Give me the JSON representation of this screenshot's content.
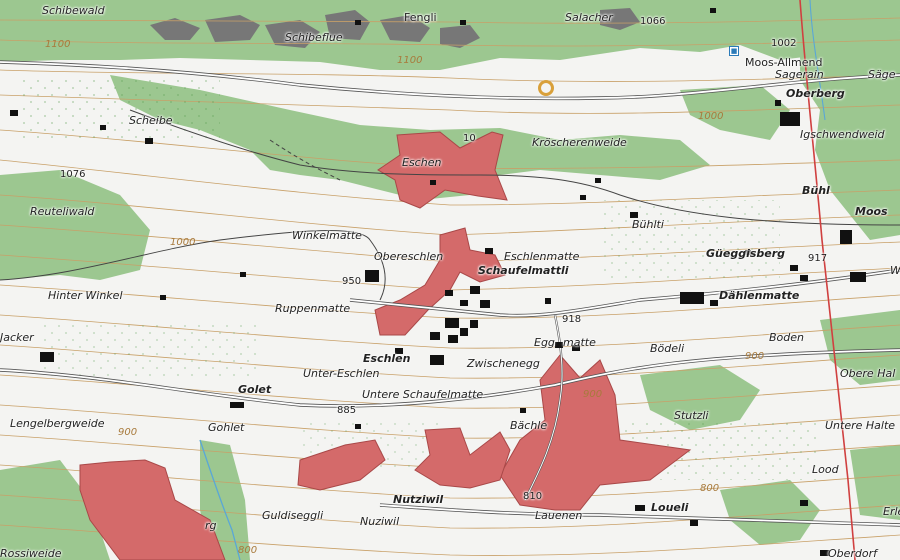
{
  "map": {
    "colors": {
      "terrain": "#f4f4f2",
      "forest": "#9cc790",
      "forest_dark": "#88b47c",
      "contour": "#c8a068",
      "zone": "#d46a6a",
      "zone_stroke": "#a94848",
      "road": "#ffffff",
      "road_casing": "#666666",
      "railway": "#d04040",
      "water": "#5aa7d6",
      "building": "#111111"
    },
    "icons": [
      "hut-icon",
      "spring-icon"
    ],
    "places": [
      {
        "name": "Schibewald",
        "style": "it"
      },
      {
        "name": "Fengli",
        "style": ""
      },
      {
        "name": "Salacher",
        "style": "it"
      },
      {
        "name": "Schibeflue",
        "style": "it"
      },
      {
        "name": "Moos-Allmend",
        "style": ""
      },
      {
        "name": "Sagerain",
        "style": "it"
      },
      {
        "name": "Säge",
        "style": "it"
      },
      {
        "name": "Oberberg",
        "style": "bd it"
      },
      {
        "name": "Igschwendweid",
        "style": "it"
      },
      {
        "name": "Scheibe",
        "style": "it"
      },
      {
        "name": "Kröscherenweide",
        "style": "it"
      },
      {
        "name": "Eschen",
        "style": "it"
      },
      {
        "name": "Bühl",
        "style": "bd it"
      },
      {
        "name": "Moos",
        "style": "bd it"
      },
      {
        "name": "Reuteliwald",
        "style": "it"
      },
      {
        "name": "Bühlti",
        "style": "it"
      },
      {
        "name": "Winkelmatte",
        "style": "it"
      },
      {
        "name": "Obereschlen",
        "style": "it"
      },
      {
        "name": "Eschlenmatte",
        "style": "it"
      },
      {
        "name": "Schaufelmattli",
        "style": "bd it"
      },
      {
        "name": "Güeggisberg",
        "style": "bd it"
      },
      {
        "name": "Hinter Winkel",
        "style": "it"
      },
      {
        "name": "Dählenmatte",
        "style": "bd it"
      },
      {
        "name": "W",
        "style": "it"
      },
      {
        "name": "Ruppenmatte",
        "style": "it"
      },
      {
        "name": "Jacker",
        "style": "it"
      },
      {
        "name": "Boden",
        "style": "it"
      },
      {
        "name": "Eschlen",
        "style": "bd it"
      },
      {
        "name": "Egg",
        "style": "it"
      },
      {
        "name": "matte",
        "style": "it"
      },
      {
        "name": "Bödeli",
        "style": "it"
      },
      {
        "name": "Zwischenegg",
        "style": "it"
      },
      {
        "name": "Unter-Eschlen",
        "style": "it"
      },
      {
        "name": "Obere Hal",
        "style": "it"
      },
      {
        "name": "Golet",
        "style": "bd it"
      },
      {
        "name": "Untere Schaufelmatte",
        "style": "it"
      },
      {
        "name": "Stutzli",
        "style": "it"
      },
      {
        "name": "Lengelbergweide",
        "style": "it"
      },
      {
        "name": "Gohlet",
        "style": "it"
      },
      {
        "name": "Bächle",
        "style": "it"
      },
      {
        "name": "Untere Halte",
        "style": "it"
      },
      {
        "name": "Lood",
        "style": "it"
      },
      {
        "name": "Nutziwil",
        "style": "bd it"
      },
      {
        "name": "Erle",
        "style": "it"
      },
      {
        "name": "Loueli",
        "style": "bd it"
      },
      {
        "name": "Lauenen",
        "style": "it"
      },
      {
        "name": "Guldiseggli",
        "style": "it"
      },
      {
        "name": "Nuziwil",
        "style": "it"
      },
      {
        "name": "Rossiweide",
        "style": "it"
      },
      {
        "name": "Oberdorf",
        "style": "it"
      },
      {
        "name": "rg",
        "style": "it"
      }
    ],
    "spot_heights": [
      "1066",
      "1002",
      "10",
      "1076",
      "950",
      "917",
      "918",
      "885",
      "810"
    ],
    "contour_labels": [
      "1100",
      "1100",
      "1000",
      "1000",
      "900",
      "900",
      "900",
      "800",
      "800"
    ]
  }
}
